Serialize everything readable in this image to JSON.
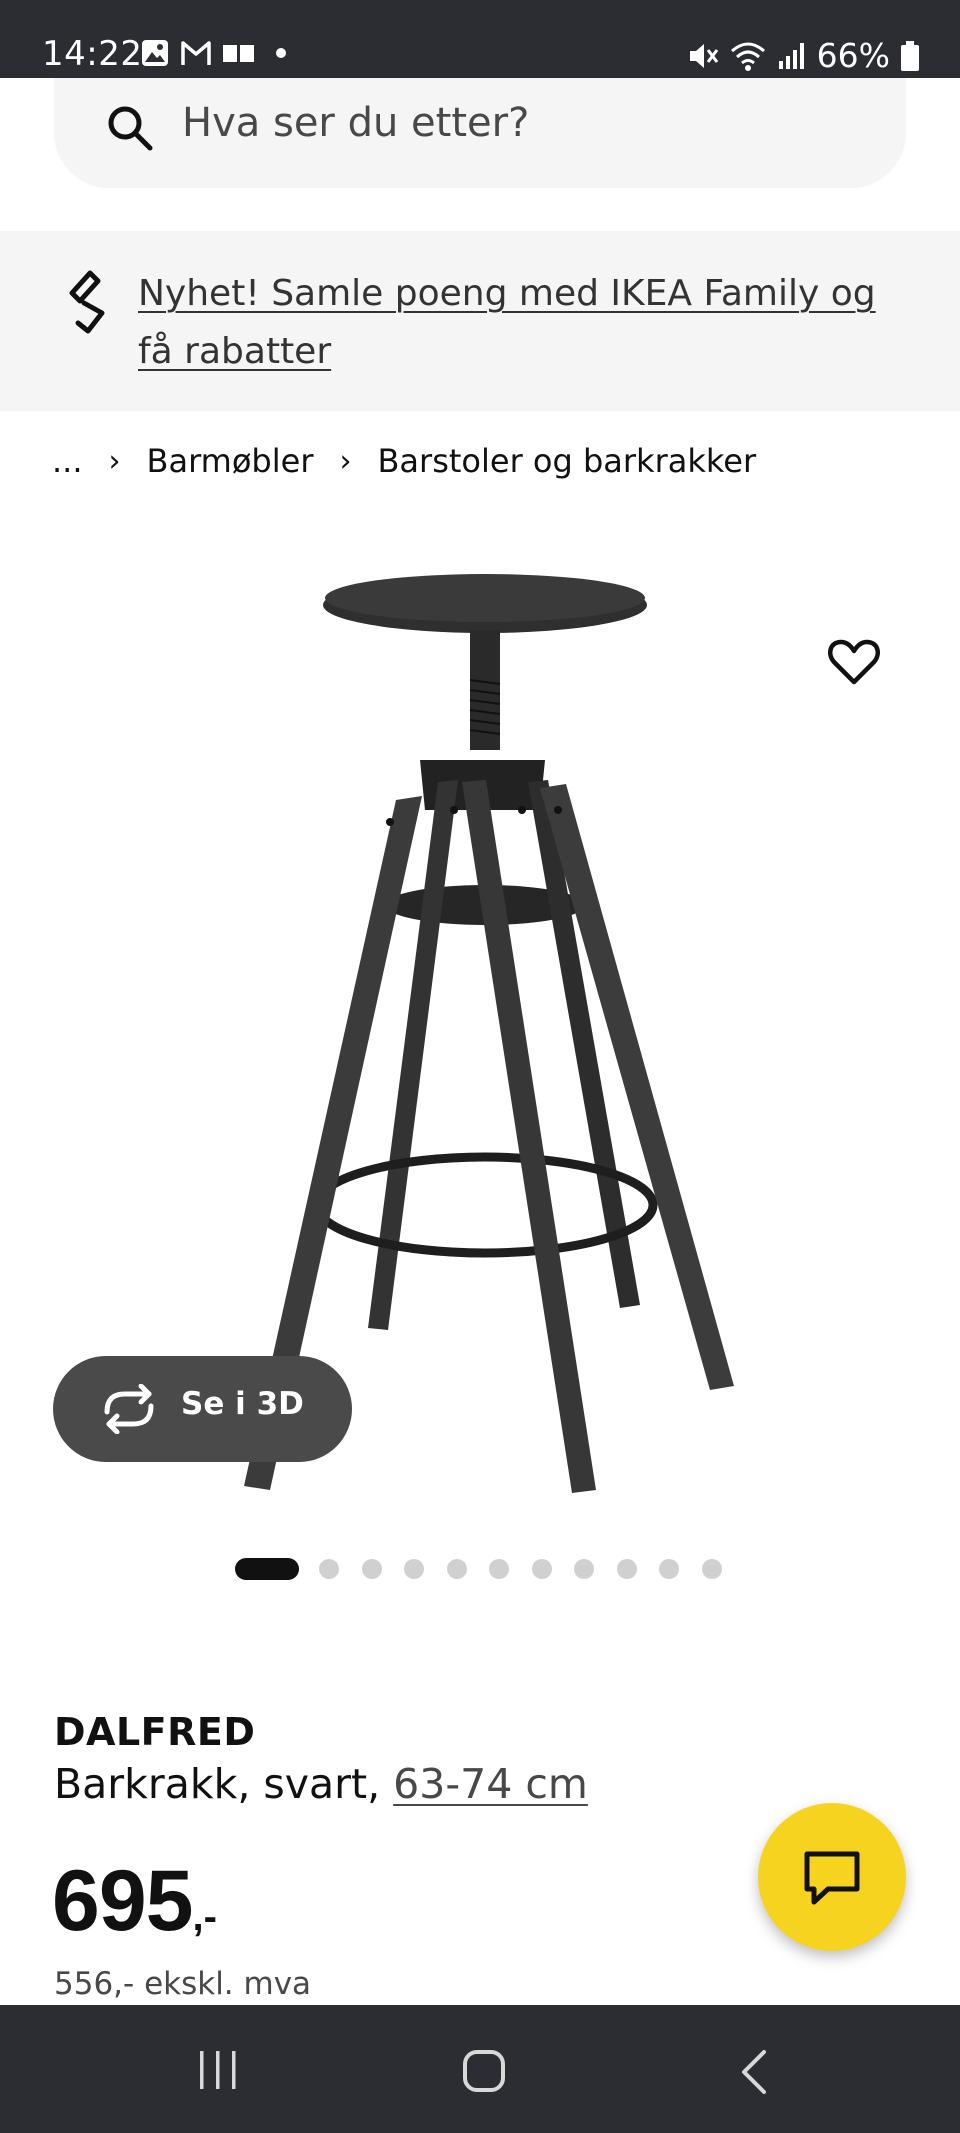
{
  "status_bar": {
    "time": "14:22",
    "battery": "66%",
    "left_icons": [
      "gallery-icon",
      "gmail-icon",
      "news-icon",
      "dot-icon"
    ],
    "right_icons": [
      "mute-icon",
      "wifi-icon",
      "signal-icon",
      "battery-icon"
    ]
  },
  "search": {
    "placeholder": "Hva ser du etter?"
  },
  "promo": {
    "text": "Nyhet! Samle poeng med IKEA Family og få rabatter",
    "icon": "link-icon"
  },
  "breadcrumb": {
    "items": [
      "...",
      "Barmøbler",
      "Barstoler og barkrakker"
    ]
  },
  "gallery": {
    "view_3d_label": "Se i 3D",
    "total_images": 11,
    "active_index": 0
  },
  "product": {
    "name": "DALFRED",
    "description": "Barkrakk, svart,",
    "size": "63-74 cm",
    "price": "695",
    "price_suffix": ",-",
    "price_excl_vat": "556,- ekskl. mva"
  },
  "colors": {
    "accent_yellow": "#f6d31e",
    "system_bar": "#2b2d33",
    "light_gray": "#f5f5f5"
  }
}
